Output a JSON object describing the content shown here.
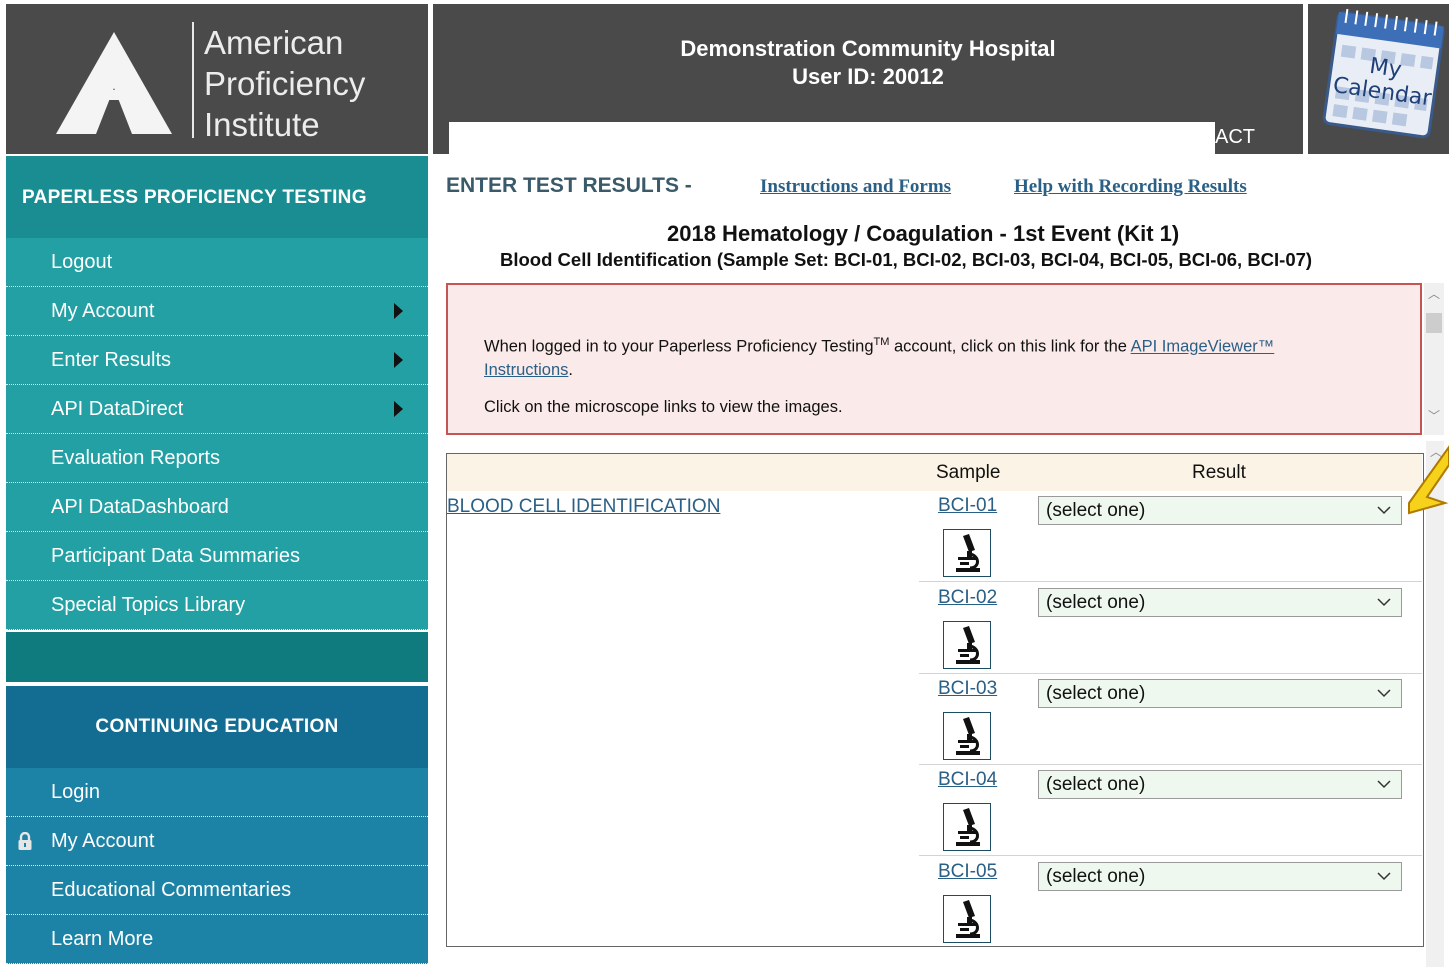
{
  "header": {
    "logo_lines": [
      "American",
      "Proficiency",
      "Institute"
    ],
    "hospital_name": "Demonstration Community Hospital",
    "user_id": "User ID: 20012",
    "contact_fragment": "ACT",
    "calendar_label_1": "My",
    "calendar_label_2": "Calendar"
  },
  "sidebar": {
    "ppt_title": "PAPERLESS PROFICIENCY TESTING",
    "ppt_items": [
      {
        "label": "Logout"
      },
      {
        "label": "My Account"
      },
      {
        "label": "Enter Results"
      },
      {
        "label": "API DataDirect"
      },
      {
        "label": "Evaluation Reports"
      },
      {
        "label": "API DataDashboard"
      },
      {
        "label": "Participant Data Summaries"
      },
      {
        "label": "Special Topics Library"
      }
    ],
    "ce_title": "CONTINUING EDUCATION",
    "ce_items": [
      {
        "label": "Login"
      },
      {
        "label": "My Account"
      },
      {
        "label": "Educational Commentaries"
      },
      {
        "label": "Learn More"
      }
    ]
  },
  "main": {
    "section_title": "ENTER TEST RESULTS -",
    "link_instructions": "Instructions and Forms",
    "link_help": "Help with Recording Results",
    "event_title": "2018 Hematology / Coagulation - 1st Event (Kit 1)",
    "event_subtitle": "Blood Cell Identification (Sample Set: BCI-01, BCI-02, BCI-03, BCI-04, BCI-05, BCI-06, BCI-07)",
    "notice": {
      "text_before": "When logged in to your Paperless Proficiency Testing",
      "tm": "TM",
      "text_after": " account, click on this link for the ",
      "link_text_1": "API ImageViewer™",
      "link_text_2": "Instructions",
      "period": ".",
      "line2": "Click on the microscope links to view the images."
    },
    "table": {
      "col_sample": "Sample",
      "col_result": "Result",
      "test_name": "BLOOD CELL IDENTIFICATION",
      "rows": [
        {
          "sample": "BCI-01",
          "result": "(select one)"
        },
        {
          "sample": "BCI-02",
          "result": "(select one)"
        },
        {
          "sample": "BCI-03",
          "result": "(select one)"
        },
        {
          "sample": "BCI-04",
          "result": "(select one)"
        },
        {
          "sample": "BCI-05",
          "result": "(select one)"
        }
      ]
    }
  },
  "colors": {
    "ppt_header": "#1a8d93",
    "ppt_item": "#22a0a4",
    "ce_header": "#136d92",
    "ce_item": "#1c83a6",
    "link": "#2a5f86",
    "notice_bg": "#fbeaea",
    "notice_border": "#c55454"
  }
}
